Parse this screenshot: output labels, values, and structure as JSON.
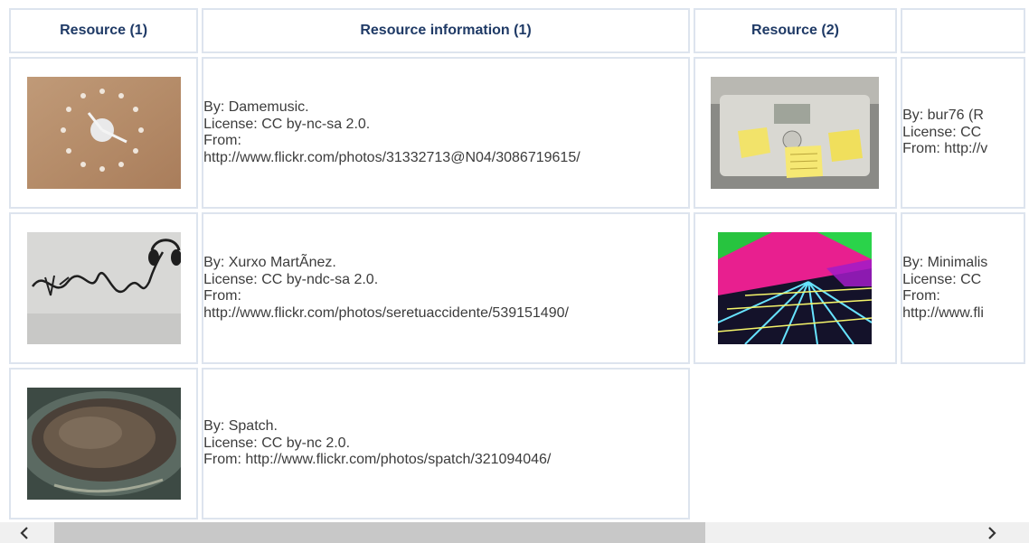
{
  "headers": [
    "Resource (1)",
    "Resource information (1)",
    "Resource (2)",
    ""
  ],
  "rows": [
    {
      "left": {
        "image": "wall-clock-photo",
        "by": "By: Damemusic.",
        "license": "License: CC by-nc-sa 2.0.",
        "from1": "From:",
        "from2": "http://www.flickr.com/photos/31332713@N04/3086719615/"
      },
      "right": {
        "image": "printer-sticky-notes-photo",
        "by": "By: bur76 (R",
        "license": "License: CC",
        "from1": "From: http://v",
        "from2": ""
      }
    },
    {
      "left": {
        "image": "headphones-graffiti-photo",
        "by": "By: Xurxo MartÃnez.",
        "license": "License: CC by-ndc-sa 2.0.",
        "from1": "From:",
        "from2": "http://www.flickr.com/photos/seretuaccidente/539151490/"
      },
      "right": {
        "image": "colorful-laser-grid-photo",
        "by": "By: Minimalis",
        "license": "License: CC",
        "from1": "From:",
        "from2": "http://www.fli"
      }
    },
    {
      "left": {
        "image": "time-capsule-plaque-photo",
        "by": "By: Spatch.",
        "license": "License: CC by-nc 2.0.",
        "from1": "From: http://www.flickr.com/photos/spatch/321094046/",
        "from2": ""
      }
    }
  ],
  "scrollbar": {
    "left_icon": "chevron-left-icon",
    "right_icon": "chevron-right-icon"
  }
}
